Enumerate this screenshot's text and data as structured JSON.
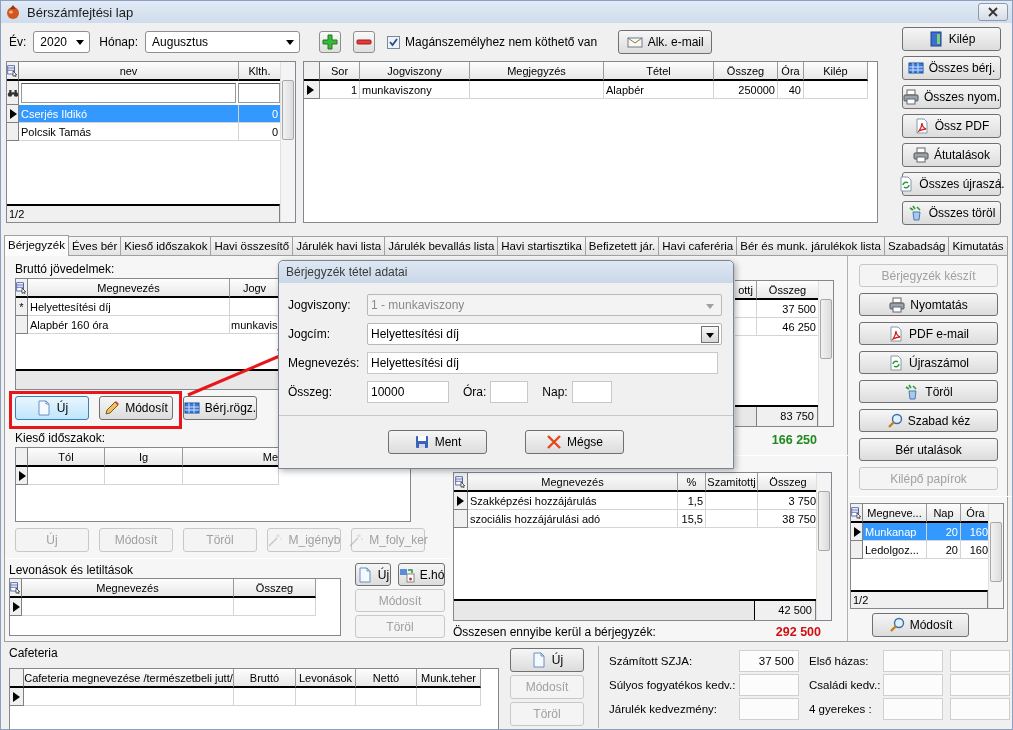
{
  "window": {
    "title": "Bérszámfejtési lap"
  },
  "toolbar": {
    "year_label": "Év:",
    "year": "2020",
    "month_label": "Hónap:",
    "month": "Augusztus",
    "checkbox": {
      "label": "Magánszemélyhez nem köthető van",
      "checked": true
    },
    "email_button": "Alk. e-mail"
  },
  "employees": {
    "columns": [
      "nev",
      "Klth."
    ],
    "rows": [
      {
        "cells": [
          "Cserjés Ildikó",
          "0"
        ],
        "selected": true
      },
      {
        "cells": [
          "Polcsik Tamás",
          "0"
        ],
        "selected": false
      }
    ],
    "footer": "1/2"
  },
  "contracts": {
    "columns": [
      "Sor",
      "Jogviszony",
      "Megjegyzés",
      "Tétel",
      "Összeg",
      "Óra",
      "Kilép"
    ],
    "rows": [
      {
        "cells": [
          "1",
          "munkaviszony",
          null,
          "Alapbér",
          "250000",
          "40",
          null
        ],
        "selected": true
      }
    ]
  },
  "side_buttons": [
    "Kilép",
    "Összes bérj.",
    "Összes nyom.",
    "Össz PDF",
    "Átutalások",
    "Összes újraszá.",
    "Összes töröl"
  ],
  "tabs": [
    {
      "label": "Bérjegyzék",
      "selected": true
    },
    {
      "label": "Éves bér",
      "selected": false
    },
    {
      "label": "Kieső időszakok",
      "selected": false
    },
    {
      "label": "Havi összesítő",
      "selected": false
    },
    {
      "label": "Járulék havi lista",
      "selected": false
    },
    {
      "label": "Járulék bevallás lista",
      "selected": false
    },
    {
      "label": "Havi startisztika",
      "selected": false
    },
    {
      "label": "Befizetett jár.",
      "selected": false
    },
    {
      "label": "Havi caferéria",
      "selected": false
    },
    {
      "label": "Bér és munk. járulékok lista",
      "selected": false
    },
    {
      "label": "Szabadság",
      "selected": false
    },
    {
      "label": "Kimutatás",
      "selected": false
    }
  ],
  "gross_income": {
    "label": "Bruttó jövedelmek:",
    "columns": [
      "Megnevezés",
      "Jogv",
      "ottj",
      "Összeg"
    ],
    "rows": [
      {
        "marker": "*",
        "cells": [
          "Helyettesítési díj",
          null,
          null,
          "37 500"
        ]
      },
      {
        "cells": [
          "Alapbér 160 óra",
          "munkavis",
          null,
          "46 250"
        ]
      }
    ],
    "total": "83 750",
    "grand_total": "166 250",
    "buttons": [
      "Új",
      "Módosít",
      "Bérj.rögz."
    ]
  },
  "absence": {
    "label": "Kieső időszakok:",
    "columns": [
      "Tól",
      "Ig",
      "Me"
    ],
    "rows": [
      {
        "cells": [
          null,
          null,
          null
        ],
        "selected": true
      }
    ],
    "buttons": [
      {
        "label": "Új",
        "disabled": true
      },
      {
        "label": "Módosít",
        "disabled": true
      },
      {
        "label": "Töröl",
        "disabled": true
      },
      {
        "label": "M_igényb",
        "disabled": true
      },
      {
        "label": "M_foly_ker",
        "disabled": true
      }
    ]
  },
  "deductions": {
    "label": "Levonások és letiltások",
    "columns": [
      "Megnevezés",
      "Összeg"
    ],
    "rows": [
      {
        "cells": [
          null,
          null
        ],
        "selected": true
      }
    ],
    "buttons": [
      {
        "label": "Új",
        "disabled": false
      },
      {
        "label": "E.hó",
        "disabled": false
      },
      {
        "label": "Módosít",
        "disabled": true
      },
      {
        "label": "Töröl",
        "disabled": true
      }
    ]
  },
  "contributions": {
    "columns": [
      "Megnevezés",
      "%",
      "Szamitottj",
      "Összeg"
    ],
    "rows": [
      {
        "cells": [
          "Szakképzési hozzájárulás",
          "1,5",
          null,
          "3 750"
        ],
        "selected": true
      },
      {
        "cells": [
          "szociális hozzájárulási adó",
          "15,5",
          null,
          "38 750"
        ],
        "selected": false
      }
    ],
    "total": "42 500",
    "summary_label": "Összesen ennyibe kerül a bérjegyzék:",
    "summary_value": "292 500"
  },
  "action_buttons": [
    {
      "label": "Bérjegyzék készít",
      "disabled": true
    },
    {
      "label": "Nyomtatás",
      "disabled": false
    },
    {
      "label": "PDF e-mail",
      "disabled": false
    },
    {
      "label": "Újraszámol",
      "disabled": false
    },
    {
      "label": "Töröl",
      "disabled": false
    },
    {
      "label": "Szabad kéz",
      "disabled": false
    },
    {
      "label": "Bér utalások",
      "disabled": false
    },
    {
      "label": "Kilépő papírok",
      "disabled": true
    }
  ],
  "work_days": {
    "columns": [
      "Megneve...",
      "Nap",
      "Óra"
    ],
    "rows": [
      {
        "cells": [
          "Munkanap",
          "20",
          "160"
        ],
        "selected": true
      },
      {
        "cells": [
          "Ledolgoz...",
          "20",
          "160"
        ],
        "selected": false
      }
    ],
    "footer": "1/2",
    "button": "Módosít"
  },
  "cafeteria": {
    "label": "Cafeteria",
    "columns": [
      "Cafeteria megnevezése /természetbeli jutt/",
      "Bruttó",
      "Levonások",
      "Nettó",
      "Munk.teher"
    ],
    "rows": [
      {
        "cells": [
          null,
          null,
          null,
          null,
          null
        ],
        "selected": true
      }
    ],
    "buttons": [
      {
        "label": "Új",
        "disabled": false
      },
      {
        "label": "Módosít",
        "disabled": true
      },
      {
        "label": "Töröl",
        "disabled": true
      }
    ]
  },
  "tax": [
    {
      "label": "Számított SZJA:",
      "value": "37 500",
      "side_label": "Első házas:"
    },
    {
      "label": "Súlyos fogyatékos kedv.:",
      "side_label": "Családi kedv.:"
    },
    {
      "label": "Járulék kedvezmény:",
      "side_label": "4 gyerekes :"
    }
  ],
  "dialog": {
    "title": "Bérjegyzék tétel adatai",
    "fields": [
      {
        "label": "Jogviszony:",
        "value": "1 - munkaviszony",
        "kind": "select",
        "disabled": true
      },
      {
        "label": "Jogcím:",
        "value": "Helyettesítési díj",
        "kind": "select",
        "disabled": false
      },
      {
        "label": "Megnevezés:",
        "value": "Helyettesítési díj",
        "kind": "text",
        "disabled": false
      }
    ],
    "amount": [
      {
        "label": "Összeg:",
        "value": "10000"
      },
      {
        "label": "Óra:"
      },
      {
        "label": "Nap:"
      }
    ],
    "buttons": [
      "Ment",
      "Mégse"
    ]
  }
}
